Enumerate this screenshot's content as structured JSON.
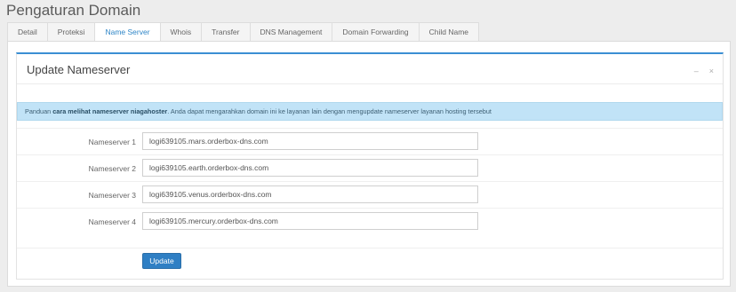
{
  "page": {
    "title": "Pengaturan Domain"
  },
  "tabs": [
    {
      "label": "Detail"
    },
    {
      "label": "Proteksi"
    },
    {
      "label": "Name Server",
      "active": true
    },
    {
      "label": "Whois"
    },
    {
      "label": "Transfer"
    },
    {
      "label": "DNS Management"
    },
    {
      "label": "Domain Forwarding"
    },
    {
      "label": "Child Name"
    }
  ],
  "panel": {
    "title": "Update Nameserver",
    "tools": {
      "collapse_icon": "minus-icon",
      "close_icon": "close-icon"
    }
  },
  "alert": {
    "prefix": "Panduan ",
    "link": "cara melihat nameserver niagahoster",
    "suffix": ". Anda dapat mengarahkan domain ini ke layanan lain dengan mengupdate nameserver layanan hosting tersebut"
  },
  "nameservers": [
    {
      "label": "Nameserver 1",
      "value": "logi639105.mars.orderbox-dns.com"
    },
    {
      "label": "Nameserver 2",
      "value": "logi639105.earth.orderbox-dns.com"
    },
    {
      "label": "Nameserver 3",
      "value": "logi639105.venus.orderbox-dns.com"
    },
    {
      "label": "Nameserver 4",
      "value": "logi639105.mercury.orderbox-dns.com"
    }
  ],
  "actions": {
    "update_label": "Update"
  },
  "colors": {
    "accent": "#2f86c7",
    "alert_bg": "#c1e3f7",
    "button": "#2f7fc4"
  }
}
